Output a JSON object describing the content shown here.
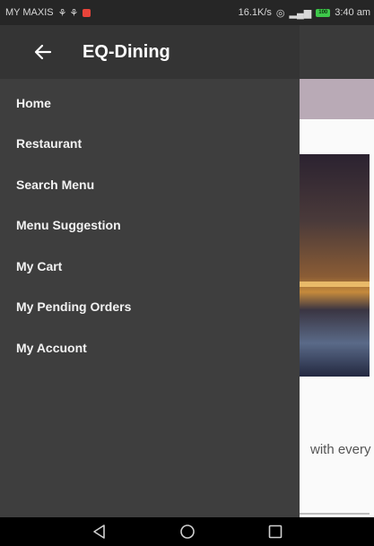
{
  "status_bar": {
    "carrier": "MY MAXIS",
    "carrier_icons": "⚘ ⚘",
    "speed": "16.1K/s",
    "battery": "100",
    "time": "3:40 am"
  },
  "drawer": {
    "title": "EQ-Dining",
    "back_icon": "arrow-left-icon",
    "items": [
      {
        "label": "Home"
      },
      {
        "label": "Restaurant"
      },
      {
        "label": "Search Menu"
      },
      {
        "label": "Menu Suggestion"
      },
      {
        "label": "My Cart"
      },
      {
        "label": "My Pending Orders"
      },
      {
        "label": "My Accuont"
      }
    ]
  },
  "background": {
    "snippet_text": "with every"
  },
  "nav_bar": {
    "icons": [
      "back-triangle-icon",
      "home-circle-icon",
      "recents-square-icon"
    ]
  },
  "colors": {
    "drawer_bg": "#3e3e3e",
    "drawer_header_bg": "#343434",
    "tab_bar_bg": "#b9aab6",
    "status_bar_bg": "#262626",
    "nav_bar_bg": "#000000"
  }
}
